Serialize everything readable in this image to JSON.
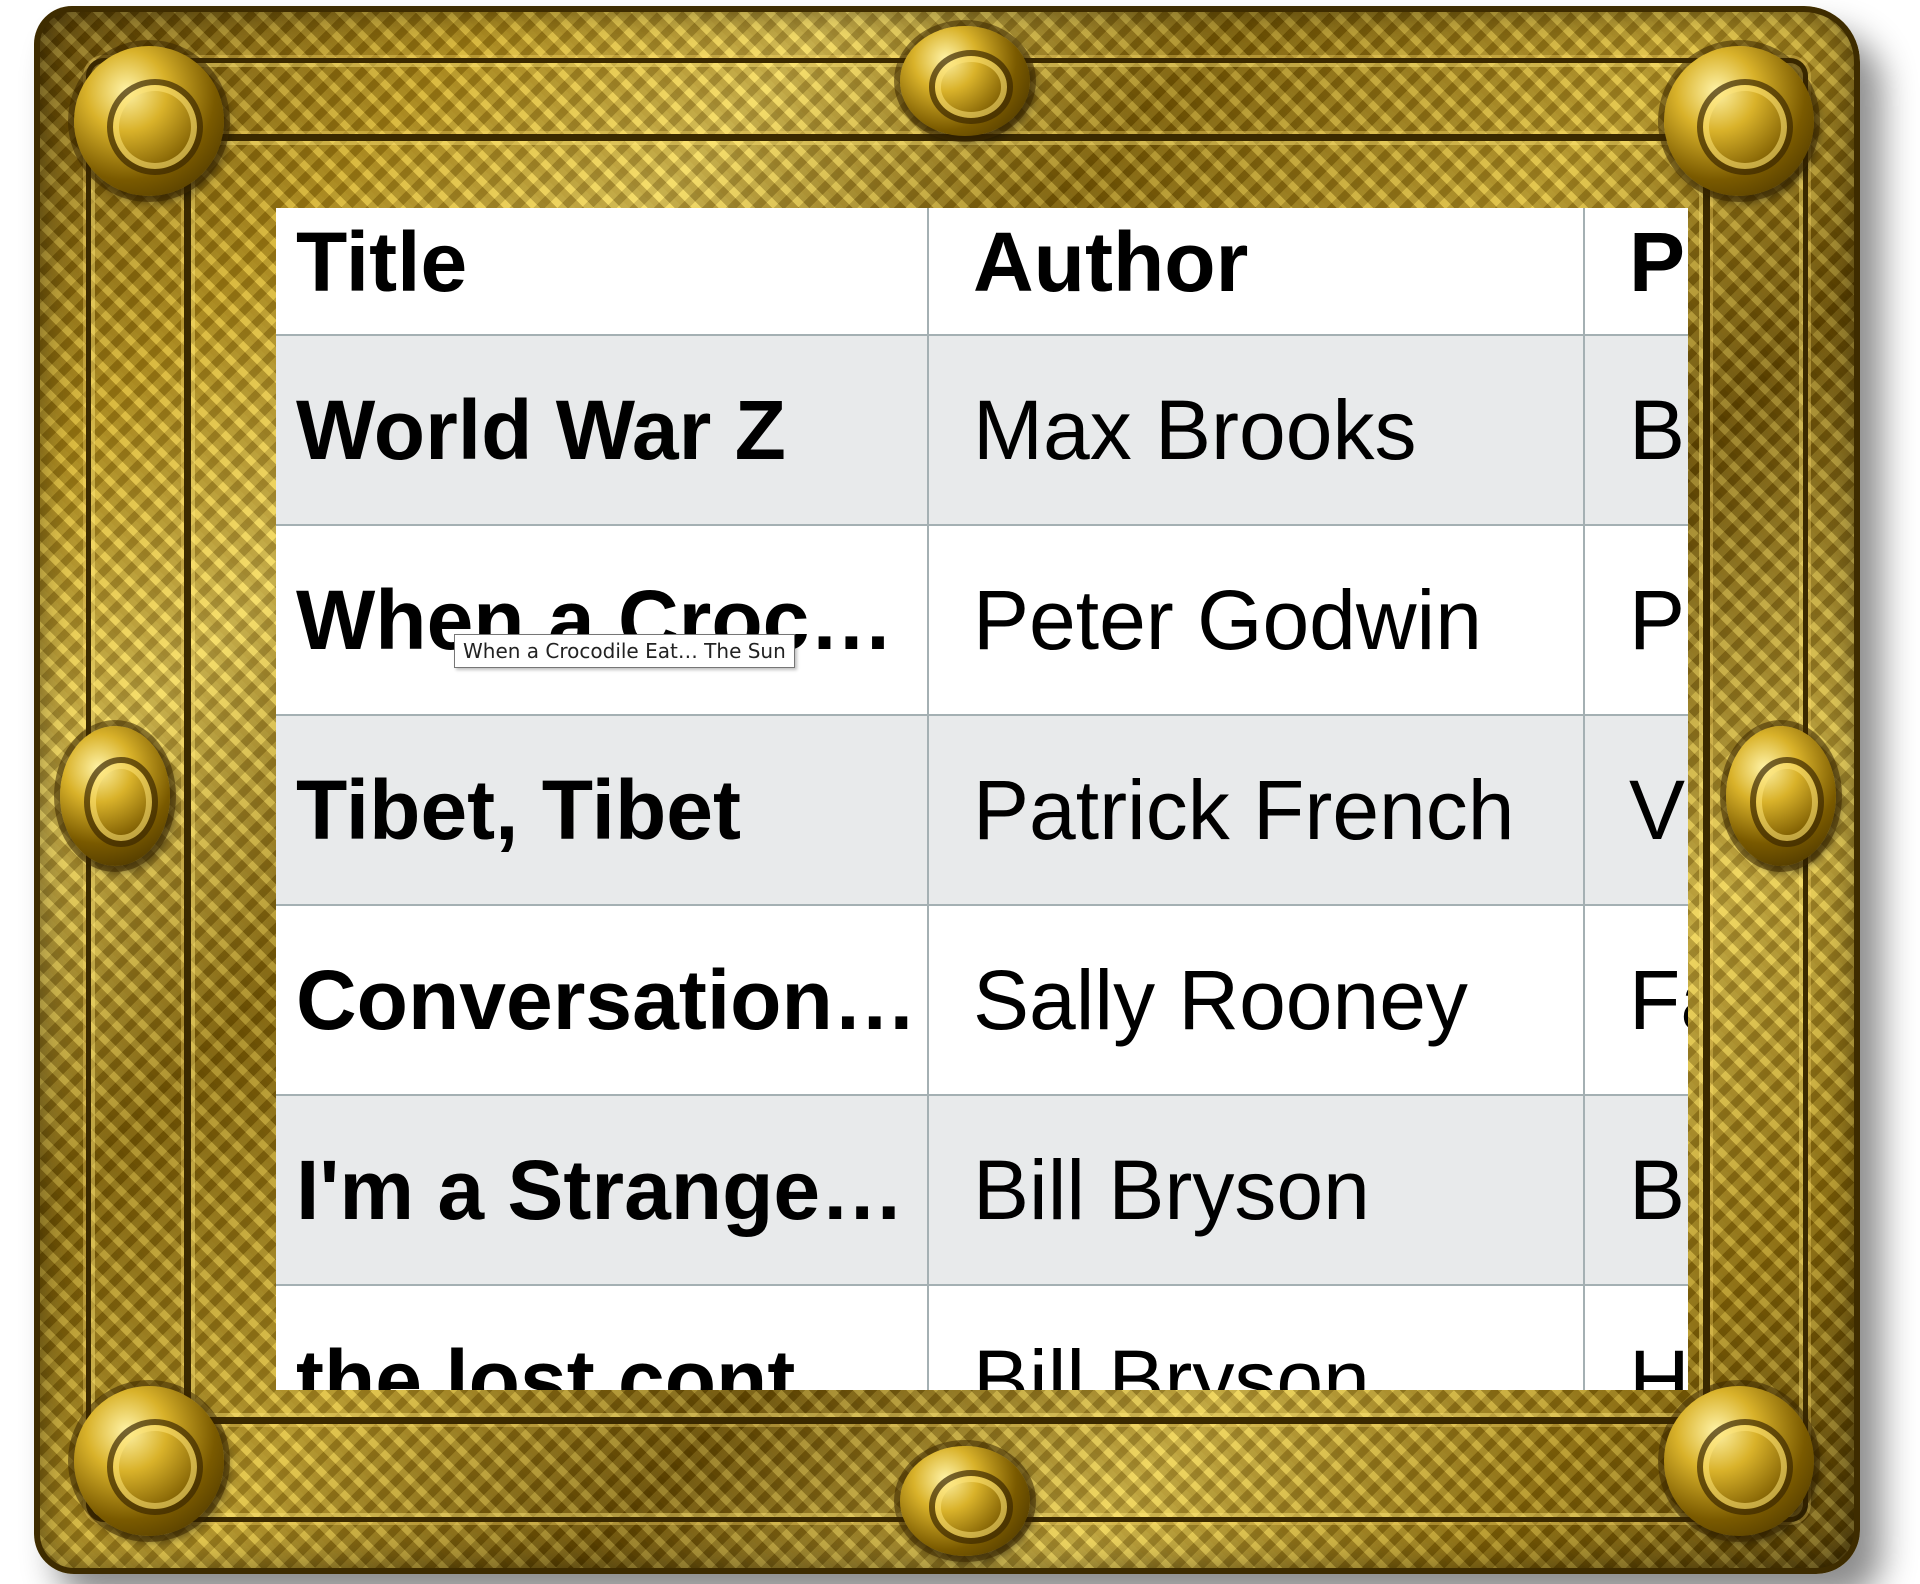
{
  "table": {
    "headers": {
      "title": "Title",
      "author": "Author",
      "publisher": "P"
    },
    "rows": [
      {
        "title": "World War Z",
        "author": "Max Brooks",
        "publisher": "B"
      },
      {
        "title": "When a Crocodile Eats The Sun",
        "author": "Peter Godwin",
        "publisher": "P"
      },
      {
        "title": "Tibet, Tibet",
        "author": "Patrick French",
        "publisher": "V"
      },
      {
        "title": "Conversations with Friends",
        "author": "Sally Rooney",
        "publisher": "Fa"
      },
      {
        "title": "I'm a Stranger Here Myself",
        "author": "Bill Bryson",
        "publisher": "B"
      },
      {
        "title": "the lost cont",
        "author": "Bill Bryson",
        "publisher": "H"
      }
    ]
  },
  "tooltip": {
    "text": "When a Crocodile Eat… The Sun"
  },
  "colors": {
    "frame_gold": "#c9a21c",
    "row_alt": "#e8eaeb",
    "grid_line": "#a4b0b3"
  }
}
